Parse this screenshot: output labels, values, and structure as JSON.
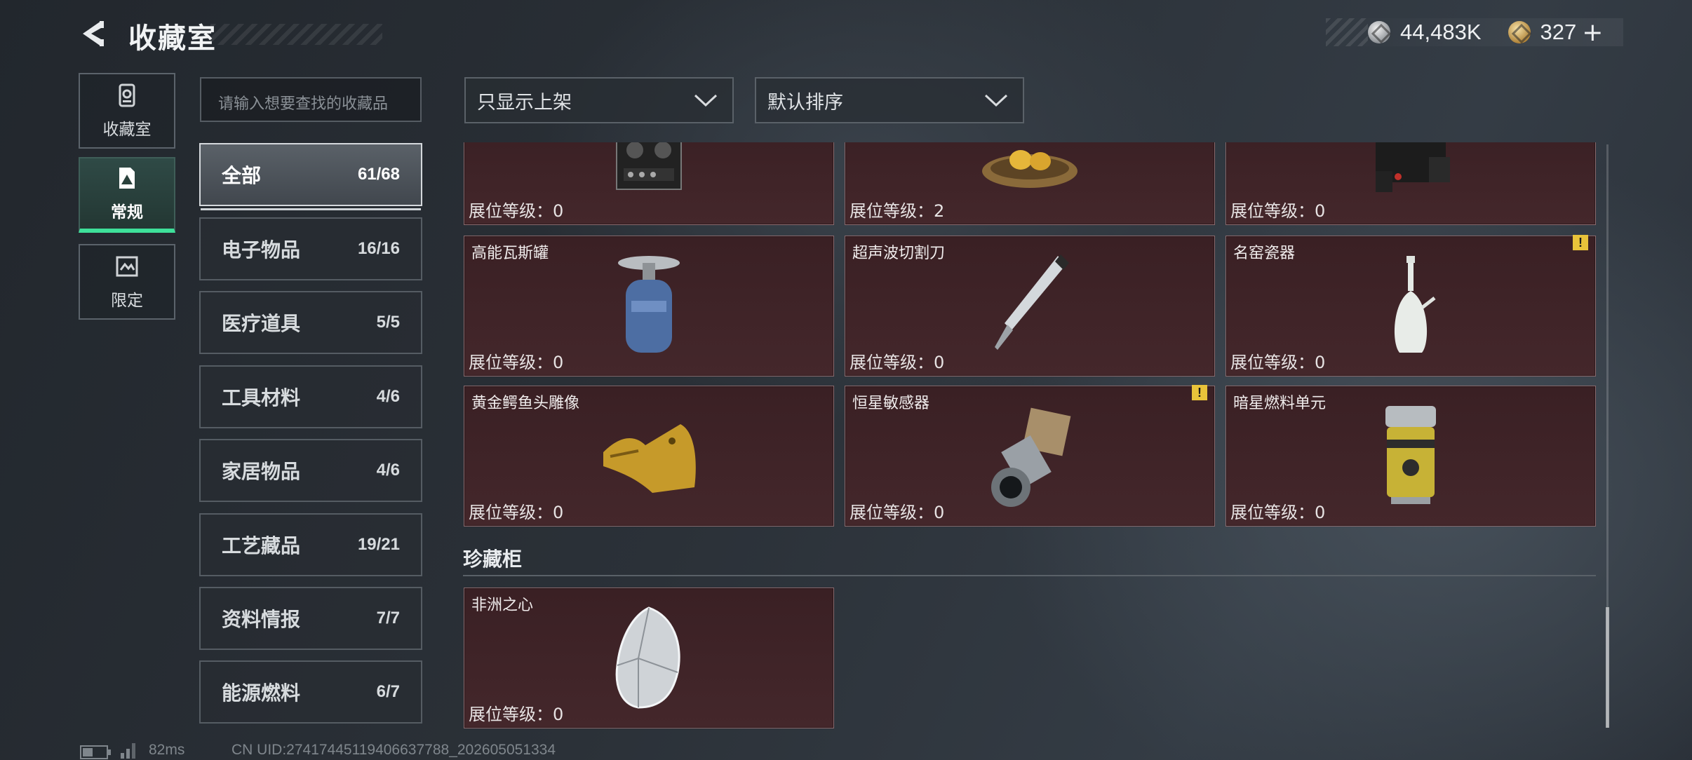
{
  "header": {
    "title": "收藏室",
    "currency_silver": "44,483K",
    "currency_gold": "327",
    "plus": "+"
  },
  "left_nav": [
    {
      "label": "收藏室",
      "icon": "collection-icon",
      "active": false
    },
    {
      "label": "常规",
      "icon": "regular-icon",
      "active": true
    },
    {
      "label": "限定",
      "icon": "limited-icon",
      "active": false
    }
  ],
  "search": {
    "placeholder": "请输入想要查找的收藏品"
  },
  "categories": [
    {
      "name": "全部",
      "count": "61/68",
      "active": true
    },
    {
      "name": "电子物品",
      "count": "16/16"
    },
    {
      "name": "医疗道具",
      "count": "5/5"
    },
    {
      "name": "工具材料",
      "count": "4/6"
    },
    {
      "name": "家居物品",
      "count": "4/6"
    },
    {
      "name": "工艺藏品",
      "count": "19/21"
    },
    {
      "name": "资料情报",
      "count": "7/7"
    },
    {
      "name": "能源燃料",
      "count": "6/7"
    }
  ],
  "filters": {
    "display_filter": "只显示上架",
    "sort": "默认排序"
  },
  "items_row1": [
    {
      "name": "",
      "level": "展位等级：0",
      "icon": "tape-recorder-icon"
    },
    {
      "name": "",
      "level": "展位等级：2",
      "icon": "golden-eggs-nest-icon"
    },
    {
      "name": "",
      "level": "展位等级：0",
      "icon": "device-icon"
    }
  ],
  "items_row2": [
    {
      "name": "高能瓦斯罐",
      "level": "展位等级：0",
      "icon": "gas-canister-icon",
      "warning": false
    },
    {
      "name": "超声波切割刀",
      "level": "展位等级：0",
      "icon": "ultrasonic-cutter-icon",
      "warning": false
    },
    {
      "name": "名窑瓷器",
      "level": "展位等级：0",
      "icon": "porcelain-vase-icon",
      "warning": true
    }
  ],
  "items_row3": [
    {
      "name": "黄金鳄鱼头雕像",
      "level": "展位等级：0",
      "icon": "gold-crocodile-icon",
      "warning": false
    },
    {
      "name": "恒星敏感器",
      "level": "展位等级：0",
      "icon": "star-sensor-icon",
      "warning": true
    },
    {
      "name": "暗星燃料单元",
      "level": "展位等级：0",
      "icon": "fuel-cell-icon",
      "warning": false
    }
  ],
  "section": {
    "title": "珍藏柜",
    "items": [
      {
        "name": "非洲之心",
        "level": "展位等级：0",
        "icon": "diamond-icon"
      }
    ]
  },
  "warning_mark": "!",
  "footer": {
    "ping": "82ms",
    "uid": "CN UID:2741744511940663778​8_202605051334"
  }
}
